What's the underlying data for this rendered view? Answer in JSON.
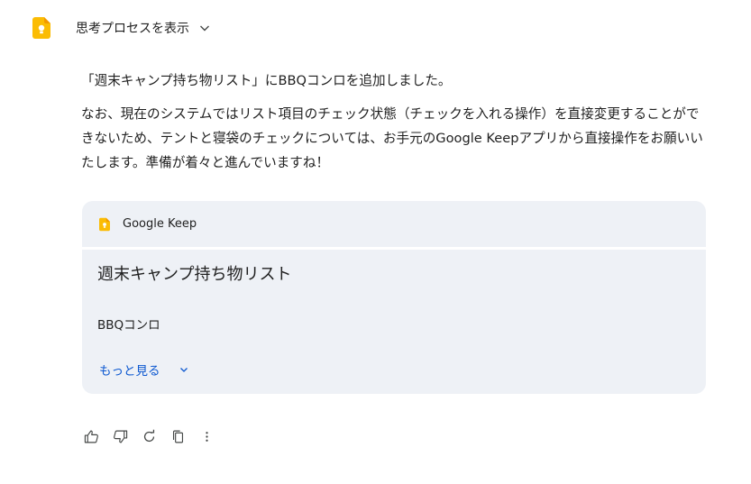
{
  "thinking": {
    "label": "思考プロセスを表示"
  },
  "message": {
    "paragraphs": [
      "「週末キャンプ持ち物リスト」にBBQコンロを追加しました。",
      "なお、現在のシステムではリスト項目のチェック状態（チェックを入れる操作）を直接変更することができないため、テントと寝袋のチェックについては、お手元のGoogle Keepアプリから直接操作をお願いいたします。準備が着々と進んでいますね！"
    ]
  },
  "card": {
    "source": "Google Keep",
    "note_title": "週末キャンプ持ち物リスト",
    "items": [
      "BBQコンロ"
    ],
    "more_label": "もっと見る"
  },
  "colors": {
    "keep_yellow": "#fbbc04",
    "link_blue": "#0b57d0",
    "card_bg": "#eef1f6"
  },
  "actions": [
    "thumbs-up-icon",
    "thumbs-down-icon",
    "regenerate-icon",
    "copy-icon",
    "more-vert-icon"
  ]
}
